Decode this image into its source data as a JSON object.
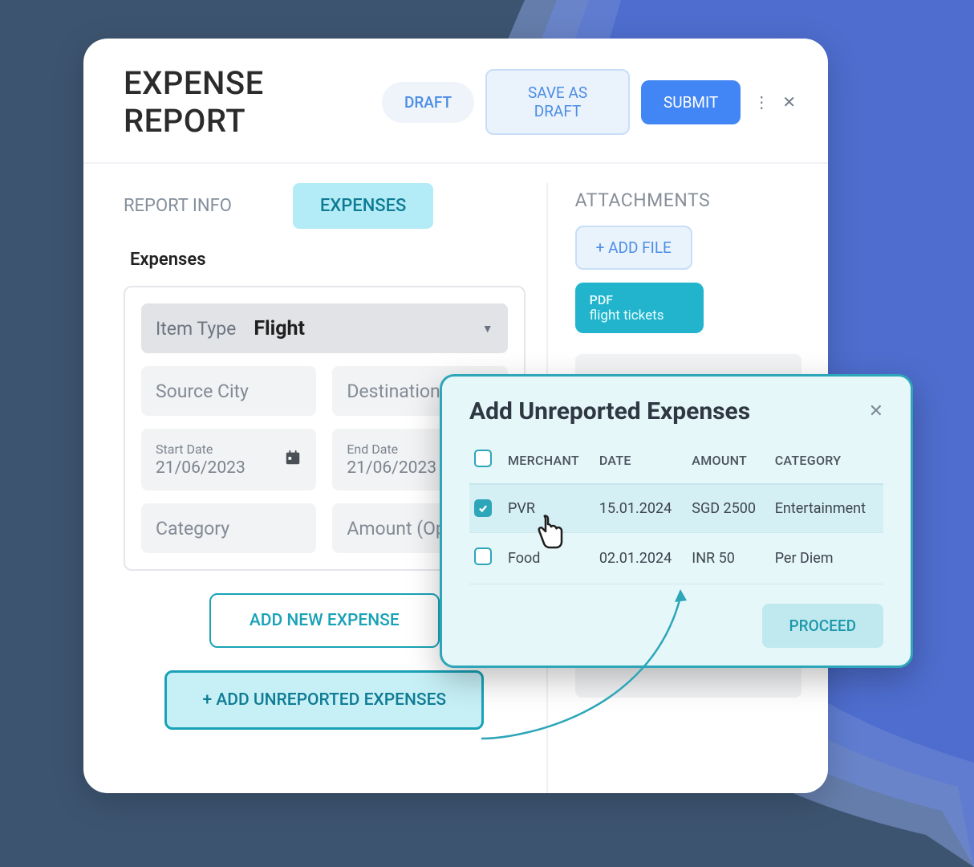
{
  "header": {
    "title": "EXPENSE REPORT",
    "status": "DRAFT",
    "save_draft_label": "SAVE AS DRAFT",
    "submit_label": "SUBMIT"
  },
  "tabs": {
    "report_info": "REPORT INFO",
    "expenses": "EXPENSES"
  },
  "section_label": "Expenses",
  "item_type": {
    "label": "Item Type",
    "value": "Flight"
  },
  "fields": {
    "source_city": "Source City",
    "destination": "Destination",
    "start_date_label": "Start Date",
    "start_date_value": "21/06/2023",
    "end_date_label": "End Date",
    "end_date_value": "21/06/2023",
    "category": "Category",
    "amount": "Amount (Op"
  },
  "buttons": {
    "add_new_expense": "ADD NEW EXPENSE",
    "add_unreported": "+ ADD UNREPORTED EXPENSES"
  },
  "attachments": {
    "heading": "ATTACHMENTS",
    "add_file": "+ ADD FILE",
    "file_type": "PDF",
    "file_name": "flight tickets"
  },
  "popup": {
    "title": "Add Unreported Expenses",
    "columns": {
      "merchant": "MERCHANT",
      "date": "DATE",
      "amount": "AMOUNT",
      "category": "CATEGORY"
    },
    "rows": [
      {
        "checked": true,
        "merchant": "PVR",
        "date": "15.01.2024",
        "amount": "SGD 2500",
        "category": "Entertainment"
      },
      {
        "checked": false,
        "merchant": "Food",
        "date": "02.01.2024",
        "amount": "INR 50",
        "category": "Per Diem"
      }
    ],
    "proceed": "PROCEED"
  }
}
